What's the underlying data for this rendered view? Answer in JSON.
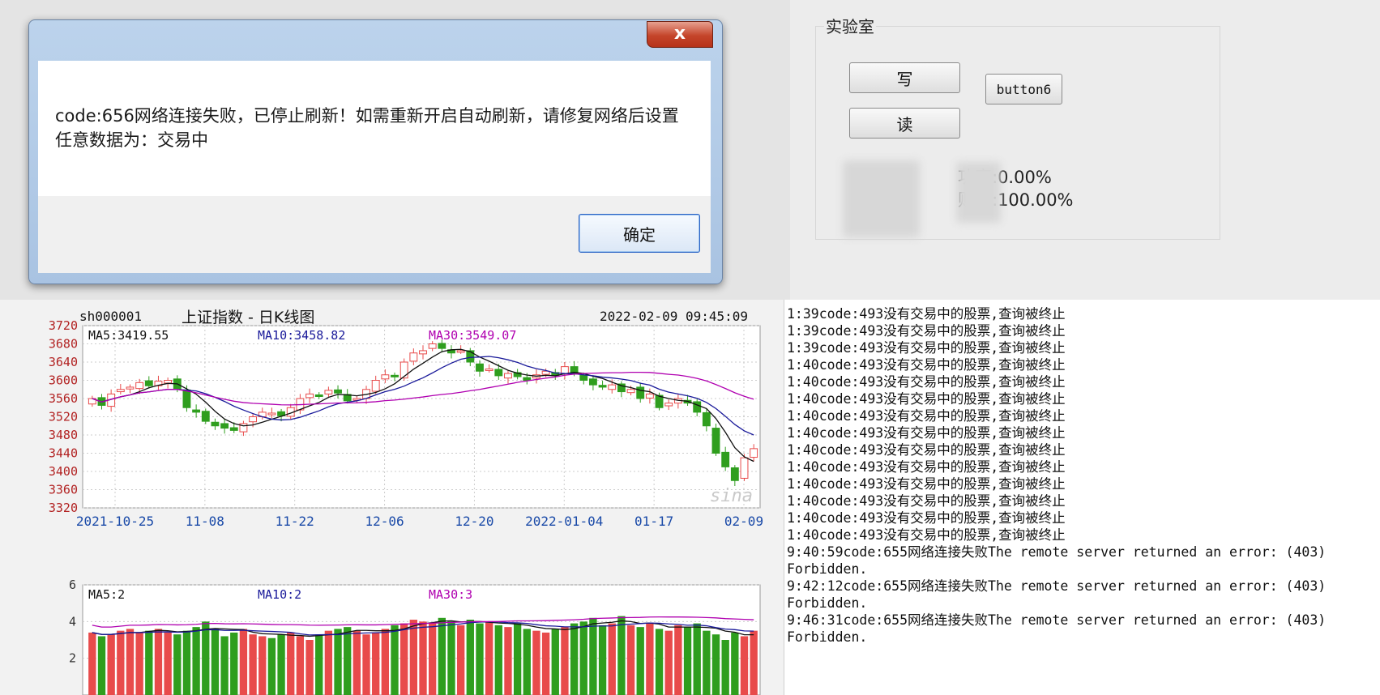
{
  "dialog": {
    "close_label": "x",
    "message": "code:656网络连接失败，已停止刷新！如需重新开启自动刷新，请修复网络后设置任意数据为：交易中",
    "ok_label": "确定"
  },
  "lab": {
    "title": "实验室",
    "write_label": "写",
    "read_label": "读",
    "button6_label": "button6",
    "stat_1": "功率:0.00%",
    "stat_2": "败率:100.00%"
  },
  "chart": {
    "ticker": "sh000001",
    "title": "上证指数 - 日K线图",
    "datetime": "2022-02-09 09:45:09",
    "ma5": "MA5:3419.55",
    "ma10": "MA10:3458.82",
    "ma30": "MA30:3549.07",
    "vol_ma5": "MA5:2",
    "vol_ma10": "MA10:2",
    "vol_ma30": "MA30:3",
    "watermark": "sina"
  },
  "chart_data": [
    {
      "type": "candlestick",
      "title": "上证指数 - 日K线图",
      "x_tick_labels": [
        "2021-10-25",
        "11-08",
        "11-22",
        "12-06",
        "12-20",
        "2022-01-04",
        "01-17",
        "02-09"
      ],
      "y_ticks": [
        3320,
        3360,
        3400,
        3440,
        3480,
        3520,
        3560,
        3600,
        3640,
        3680,
        3720
      ],
      "ylim": [
        3320,
        3720
      ],
      "close": [
        3560,
        3545,
        3570,
        3580,
        3585,
        3595,
        3588,
        3598,
        3600,
        3580,
        3540,
        3530,
        3510,
        3500,
        3495,
        3490,
        3505,
        3520,
        3530,
        3528,
        3522,
        3540,
        3560,
        3570,
        3565,
        3578,
        3572,
        3555,
        3560,
        3580,
        3600,
        3612,
        3610,
        3640,
        3660,
        3665,
        3680,
        3670,
        3660,
        3665,
        3640,
        3620,
        3625,
        3610,
        3615,
        3608,
        3600,
        3612,
        3620,
        3610,
        3630,
        3615,
        3600,
        3590,
        3585,
        3590,
        3575,
        3580,
        3560,
        3570,
        3540,
        3550,
        3560,
        3550,
        3530,
        3500,
        3440,
        3410,
        3380,
        3430,
        3450
      ],
      "ma5_line": "MA5",
      "ma10_line": "MA10",
      "ma30_line": "MA30",
      "grid": true
    },
    {
      "type": "bar",
      "title": "",
      "y_ticks": [
        2,
        4,
        6
      ],
      "ylim": [
        0,
        6
      ],
      "values": [
        3.4,
        3.2,
        3.3,
        3.5,
        3.6,
        3.4,
        3.5,
        3.6,
        3.4,
        3.3,
        3.5,
        3.7,
        4.0,
        3.6,
        3.2,
        3.4,
        3.6,
        3.3,
        3.2,
        3.1,
        3.3,
        3.4,
        3.2,
        3.0,
        3.3,
        3.5,
        3.6,
        3.7,
        3.5,
        3.3,
        3.4,
        3.6,
        3.8,
        3.9,
        4.1,
        4.0,
        3.9,
        4.2,
        4.0,
        3.8,
        4.1,
        3.9,
        4.0,
        3.8,
        3.7,
        3.9,
        3.6,
        3.5,
        3.4,
        3.6,
        3.7,
        3.9,
        4.0,
        4.2,
        3.8,
        3.9,
        4.3,
        3.8,
        3.7,
        3.9,
        3.6,
        3.5,
        3.8,
        3.7,
        3.9,
        3.5,
        3.3,
        3.0,
        3.4,
        3.2,
        3.5
      ]
    }
  ],
  "log": {
    "lines": [
      "1:39code:493没有交易中的股票,查询被终止",
      "1:39code:493没有交易中的股票,查询被终止",
      "1:39code:493没有交易中的股票,查询被终止",
      "1:40code:493没有交易中的股票,查询被终止",
      "1:40code:493没有交易中的股票,查询被终止",
      "1:40code:493没有交易中的股票,查询被终止",
      "1:40code:493没有交易中的股票,查询被终止",
      "1:40code:493没有交易中的股票,查询被终止",
      "1:40code:493没有交易中的股票,查询被终止",
      "1:40code:493没有交易中的股票,查询被终止",
      "1:40code:493没有交易中的股票,查询被终止",
      "1:40code:493没有交易中的股票,查询被终止",
      "1:40code:493没有交易中的股票,查询被终止",
      "1:40code:493没有交易中的股票,查询被终止",
      "9:40:59code:655网络连接失败The remote server returned an error: (403) Forbidden.",
      "9:42:12code:655网络连接失败The remote server returned an error: (403) Forbidden.",
      "9:46:31code:655网络连接失败The remote server returned an error: (403) Forbidden."
    ]
  },
  "colors": {
    "up": "#e84b4b",
    "down": "#2f9e1e",
    "ma30": "#b000b0",
    "axis_label": "#b22222",
    "x_label": "#1a4aa8"
  }
}
